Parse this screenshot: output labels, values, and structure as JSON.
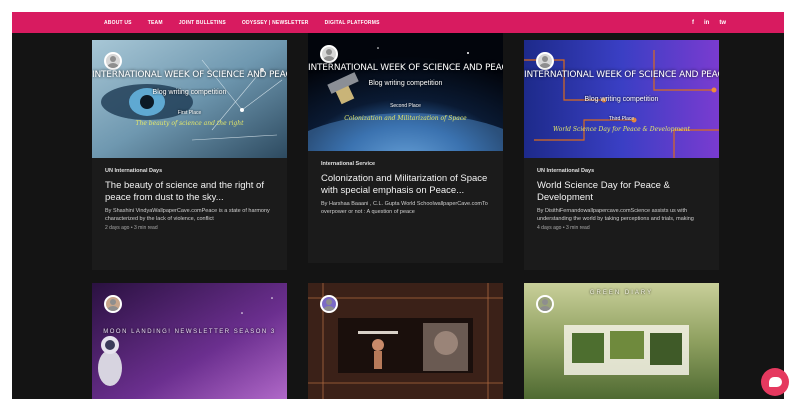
{
  "nav": [
    "ABOUT US",
    "TEAM",
    "JOINT BULLETINS",
    "ODYSSEY | NEWSLETTER",
    "DIGITAL PLATFORMS"
  ],
  "social": [
    "f",
    "in",
    "tw"
  ],
  "social_icons": [
    "facebook-icon",
    "linkedin-icon",
    "twitter-icon"
  ],
  "colors": {
    "topbar": "#d81b60",
    "background": "#141414",
    "chat": "#e5395f"
  },
  "posts": [
    {
      "image": {
        "headline": "INTERNATIONAL WEEK OF SCIENCE AND PEACE",
        "subtitle": "Blog writing competition",
        "place": "First Place",
        "script": "The beauty of science and the right"
      },
      "category": "UN International Days",
      "title": "The beauty of science and the right of peace from dust to the sky...",
      "excerpt": "By Shashini VindyaWallpaperCave.comPeace is a state of harmony characterized by the lack of violence, conflict",
      "meta": "2 days ago  •  3 min read"
    },
    {
      "image": {
        "headline": "INTERNATIONAL WEEK OF SCIENCE AND PEACE",
        "subtitle": "Blog writing competition",
        "place": "Second Place",
        "script": "Colonization and Militarization of Space"
      },
      "category": "International Service",
      "title": "Colonization and Militarization of Space with special emphasis on Peace...",
      "excerpt": "By Harshaa Baaani , C.L. Gupta World SchoolwallpaperCave.comTo overpower or not : A question of peace",
      "meta": ""
    },
    {
      "image": {
        "headline": "INTERNATIONAL WEEK OF SCIENCE AND PEACE",
        "subtitle": "Blog writing competition",
        "place": "Third Place",
        "script": "World Science Day for Peace & Development"
      },
      "category": "UN International Days",
      "title": "World Science Day for Peace & Development",
      "excerpt": "By DisithiFernandowallpapercave.comScience assists us with understanding the world by taking perceptions and trials, making",
      "meta": "4 days ago  •  3 min read"
    }
  ],
  "bottom_cards": [
    {
      "image_text": "MOON LANDING! NEWSLETTER SEASON 3"
    },
    {
      "image_text": ""
    },
    {
      "image_text": "GREEN DIARY"
    }
  ]
}
